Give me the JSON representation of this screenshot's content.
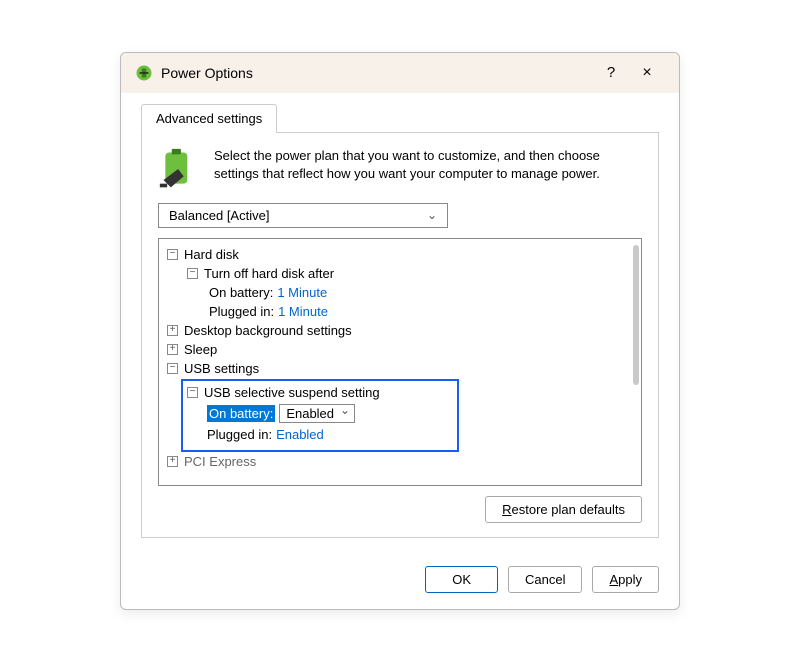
{
  "window": {
    "title": "Power Options",
    "help": "?",
    "close": "×"
  },
  "tab_label": "Advanced settings",
  "intro": "Select the power plan that you want to customize, and then choose settings that reflect how you want your computer to manage power.",
  "plan_selected": "Balanced [Active]",
  "tree": {
    "hard_disk": "Hard disk",
    "turn_off_after": "Turn off hard disk after",
    "on_battery": "On battery:",
    "on_battery_val": "1 Minute",
    "plugged_in": "Plugged in:",
    "plugged_in_val": "1 Minute",
    "desktop_bg": "Desktop background settings",
    "sleep": "Sleep",
    "usb_settings": "USB settings",
    "usb_selective": "USB selective suspend setting",
    "usb_on_battery": "On battery:",
    "usb_on_battery_val": "Enabled",
    "usb_plugged_in": "Plugged in:",
    "usb_plugged_in_val": "Enabled",
    "pci_express": "PCI Express"
  },
  "restore_defaults": "Restore plan defaults",
  "buttons": {
    "ok": "OK",
    "cancel": "Cancel",
    "apply": "Apply"
  }
}
